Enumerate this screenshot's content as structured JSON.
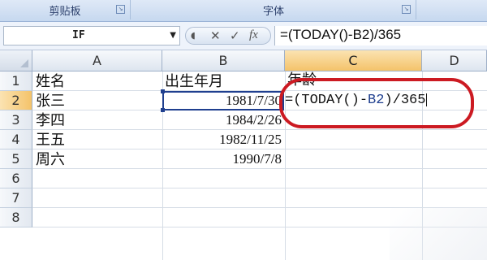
{
  "ribbon": {
    "groups": [
      {
        "label": "剪贴板"
      },
      {
        "label": "字体"
      }
    ]
  },
  "formula_bar": {
    "name_box": "IF",
    "cancel_symbol": "✕",
    "enter_symbol": "✓",
    "fx_symbol": "fx",
    "formula": "=(TODAY()-B2)/365"
  },
  "columns": [
    "A",
    "B",
    "C",
    "D"
  ],
  "rows": [
    "1",
    "2",
    "3",
    "4",
    "5",
    "6",
    "7",
    "8"
  ],
  "cells": {
    "A1": "姓名",
    "B1": "出生年月",
    "C1": "年龄",
    "A2": "张三",
    "B2": "1981/7/30",
    "A3": "李四",
    "B3": "1984/2/26",
    "A4": "王五",
    "B4": "1982/11/25",
    "A5": "周六",
    "B5": "1990/7/8"
  },
  "edit_cell": {
    "prefix": "=(TODAY()-",
    "ref": "B2",
    "suffix": ")/365"
  },
  "colors": {
    "selection_border": "#1f3f8f",
    "annotation_red": "#cc1a22",
    "active_header": "#f4c36a"
  }
}
